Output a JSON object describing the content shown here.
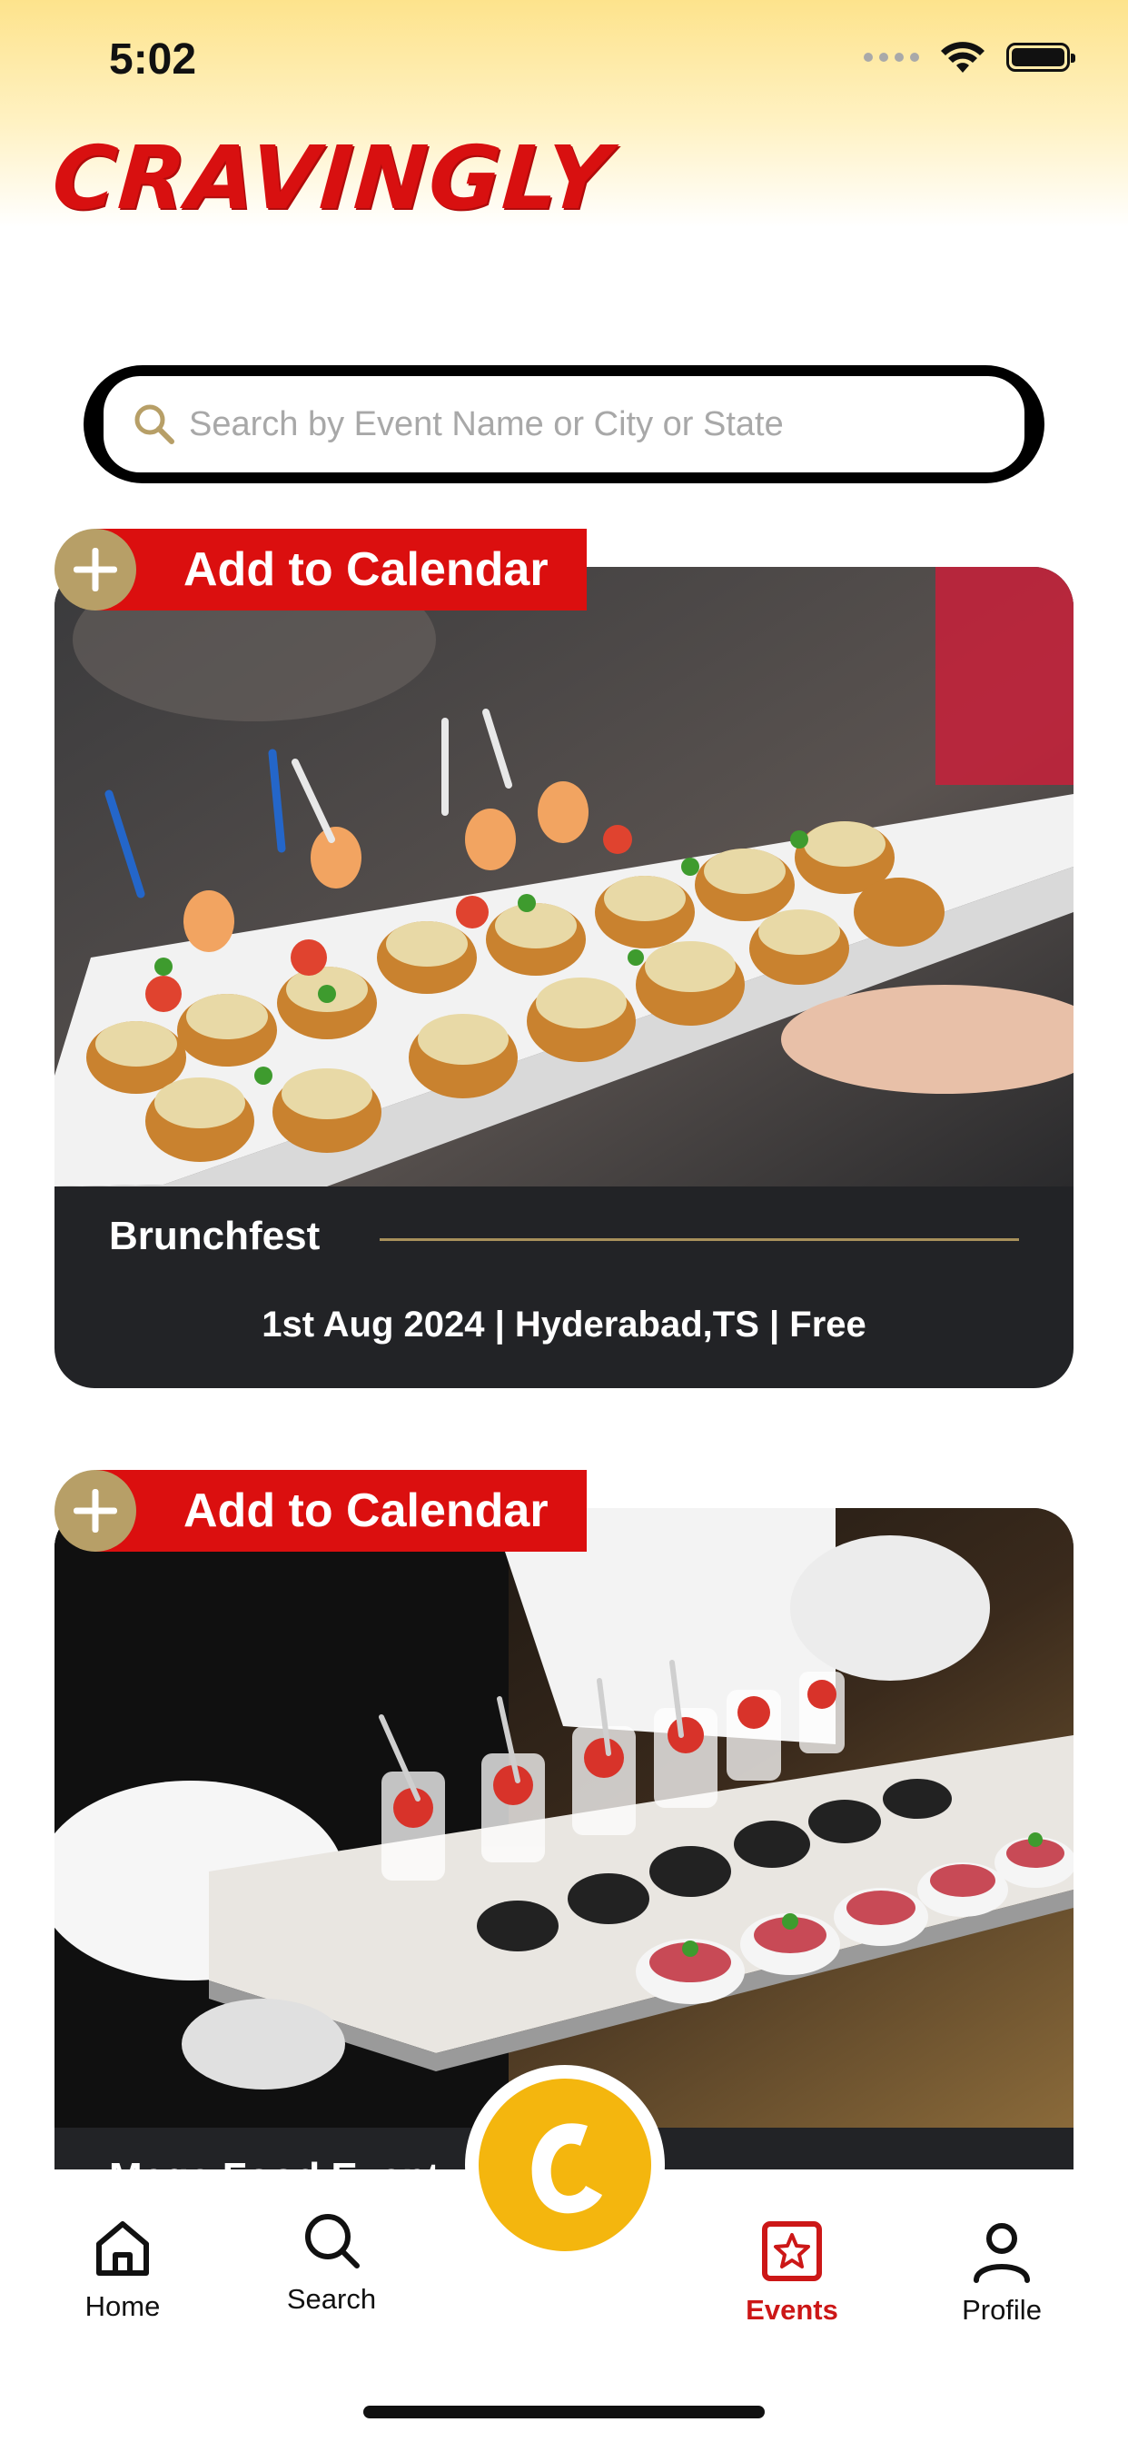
{
  "status_bar": {
    "time": "5:02"
  },
  "app": {
    "logo_text": "CRAVINGLY",
    "brand_color": "#d81010",
    "accent_color": "#b79f67"
  },
  "search": {
    "placeholder": "Search by Event Name or City or State",
    "value": "",
    "icon": "search-icon"
  },
  "calendar_button_label": "Add to Calendar",
  "events": [
    {
      "title": "Brunchfest",
      "date": "1st Aug 2024",
      "location": "Hyderabad,TS",
      "price": "Free",
      "meta": "1st Aug 2024  | Hyderabad,TS | Free"
    },
    {
      "title": "Mega Food Event"
    }
  ],
  "bottom_nav": {
    "items": [
      {
        "label": "Home",
        "icon": "home-icon"
      },
      {
        "label": "Search",
        "icon": "search-icon"
      },
      {
        "label": "Events",
        "icon": "events-star-icon",
        "active": true
      },
      {
        "label": "Profile",
        "icon": "profile-icon"
      }
    ],
    "center_button_icon": "cravingly-c-logo"
  }
}
